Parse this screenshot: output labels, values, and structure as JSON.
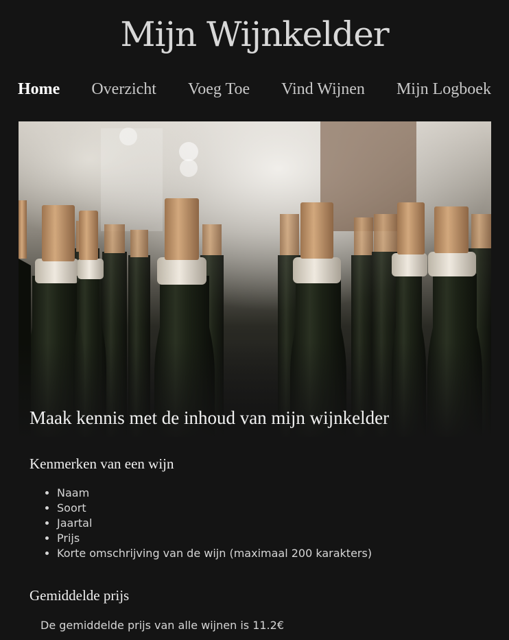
{
  "site": {
    "title": "Mijn Wijnkelder"
  },
  "nav": {
    "items": [
      {
        "label": "Home",
        "active": true
      },
      {
        "label": "Overzicht",
        "active": false
      },
      {
        "label": "Voeg Toe",
        "active": false
      },
      {
        "label": "Vind Wijnen",
        "active": false
      },
      {
        "label": "Mijn Logboek",
        "active": false
      }
    ]
  },
  "hero": {
    "image_subject": "wine-bottles-with-corks",
    "title": "Maak kennis met de inhoud van mijn wijnkelder"
  },
  "features": {
    "title": "Kenmerken van een wijn",
    "items": [
      "Naam",
      "Soort",
      "Jaartal",
      "Prijs",
      "Korte omschrijving van de wijn (maximaal 200 karakters)"
    ]
  },
  "average_price": {
    "title": "Gemiddelde prijs",
    "text": "De gemiddelde prijs van alle wijnen is 11.2€"
  },
  "colors": {
    "background": "#141414",
    "text": "#e6e6e6",
    "cork": "#c79a6b",
    "bottle_glass": "#1f2418"
  }
}
